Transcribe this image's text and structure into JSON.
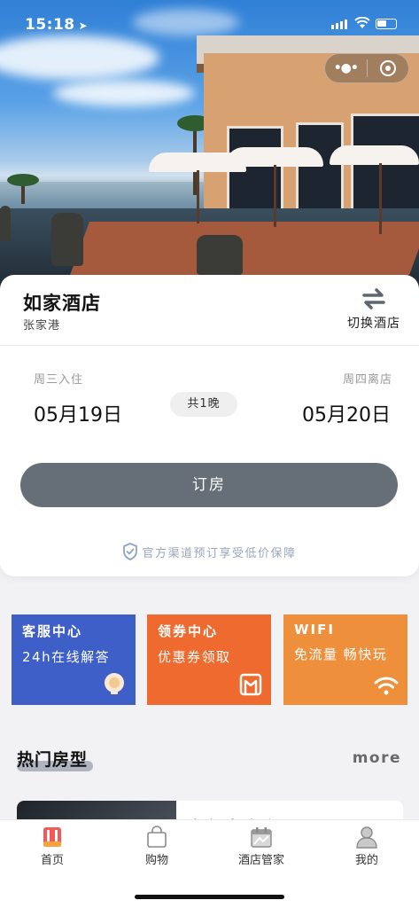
{
  "status_bar": {
    "time": "15:18"
  },
  "capsule": {
    "more_icon": "more-dots-icon",
    "close_icon": "target-close-icon"
  },
  "hotel": {
    "name": "如家酒店",
    "city": "张家港",
    "switch_label": "切换酒店"
  },
  "booking": {
    "checkin_label": "周三入住",
    "checkin_date": "05月19日",
    "nights": "共1晚",
    "checkout_label": "周四离店",
    "checkout_date": "05月20日",
    "book_button": "订房",
    "guarantee": "官方渠道预订享受低价保障"
  },
  "services": [
    {
      "title": "客服中心",
      "subtitle": "24h在线解答",
      "icon": "headset-icon",
      "color": "#3e5fc7"
    },
    {
      "title": "领券中心",
      "subtitle": "优惠券领取",
      "icon": "coupon-icon",
      "color": "#ee6a2f"
    },
    {
      "title": "WIFI",
      "subtitle": "免流量 畅快玩",
      "icon": "wifi-icon",
      "color": "#ee8f3b"
    }
  ],
  "hot_rooms": {
    "title": "热门房型",
    "more": "more",
    "first_room_name": "豪华大床房"
  },
  "tabs": [
    {
      "label": "首页",
      "icon": "home-icon",
      "active": true
    },
    {
      "label": "购物",
      "icon": "shopping-bag-icon",
      "active": false
    },
    {
      "label": "酒店管家",
      "icon": "calendar-icon",
      "active": false
    },
    {
      "label": "我的",
      "icon": "user-icon",
      "active": false
    }
  ]
}
